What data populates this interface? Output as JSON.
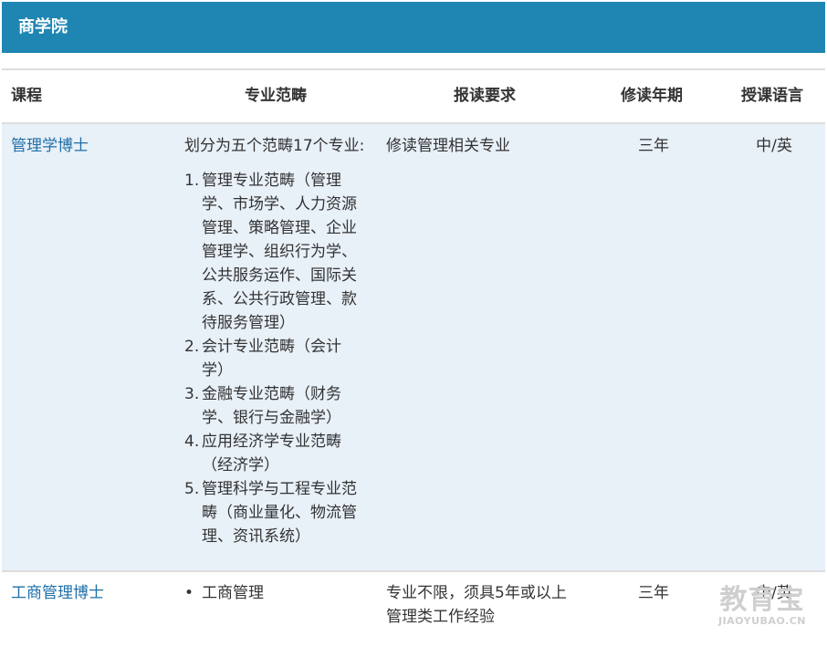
{
  "header": {
    "title": "商学院"
  },
  "columns": {
    "course": "课程",
    "category": "专业范畴",
    "requirement": "报读要求",
    "duration": "修读年期",
    "language": "授课语言"
  },
  "rows": [
    {
      "course": "管理学博士",
      "category_intro": "划分为五个范畴17个专业:",
      "category_items": [
        {
          "num": "1.",
          "lines": [
            "管理专业范畴（管理",
            "学、市场学、人力资源",
            "管理、策略管理、企业",
            "管理学、组织行为学、",
            "公共服务运作、国际关",
            "系、公共行政管理、款",
            "待服务管理）"
          ]
        },
        {
          "num": "2.",
          "lines": [
            "会计专业范畴（会计",
            "学）"
          ]
        },
        {
          "num": "3.",
          "lines": [
            "金融专业范畴（财务",
            "学、银行与金融学）"
          ]
        },
        {
          "num": "4.",
          "lines": [
            "应用经济学专业范畴",
            "（经济学）"
          ]
        },
        {
          "num": "5.",
          "lines": [
            "管理科学与工程专业范",
            "畴（商业量化、物流管",
            "理、资讯系统）"
          ]
        }
      ],
      "requirement": "修读管理相关专业",
      "duration": "三年",
      "language": "中/英"
    },
    {
      "course": "工商管理博士",
      "category_items": [
        {
          "bullet": "•",
          "text": "工商管理"
        }
      ],
      "requirement_lines": [
        "专业不限，须具5年或以上",
        "管理类工作经验"
      ],
      "duration": "三年",
      "language": "中/英"
    }
  ],
  "watermark": {
    "cn": "教育宝",
    "en": "JIAOYUBAO.CN"
  }
}
